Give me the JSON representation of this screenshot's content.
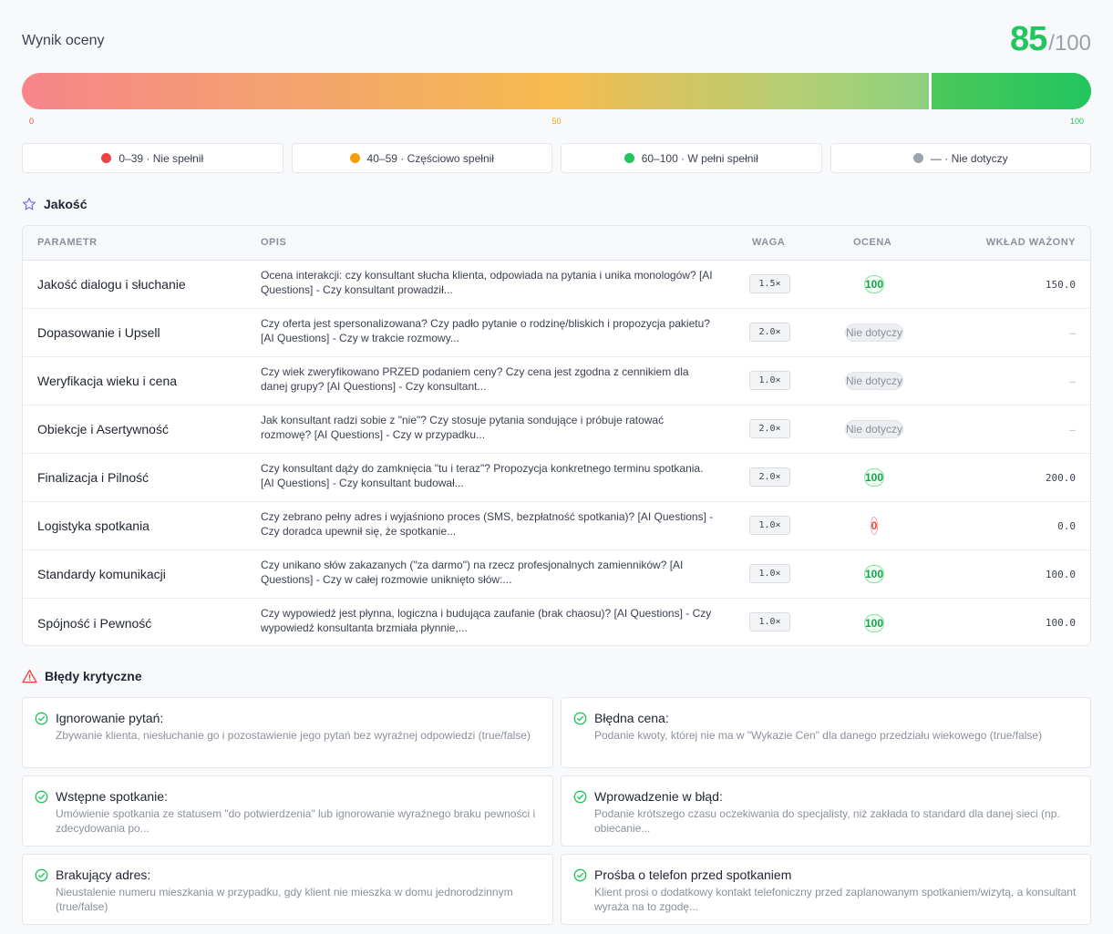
{
  "header": {
    "title": "Wynik oceny",
    "score": "85",
    "score_max": "/100"
  },
  "progress": {
    "value": 85,
    "min_label": "0",
    "mid_label": "50",
    "max_label": "100"
  },
  "legend": [
    {
      "color": "#ef4444",
      "label": "0–39 · Nie spełnił"
    },
    {
      "color": "#f59e0b",
      "label": "40–59 · Częściowo spełnił"
    },
    {
      "color": "#22c55e",
      "label": "60–100 · W pełni spełnił"
    },
    {
      "color": "#9ca3af",
      "label": "— · Nie dotyczy"
    }
  ],
  "quality": {
    "title": "Jakość",
    "columns": {
      "param": "PARAMETR",
      "desc": "OPIS",
      "weight": "WAGA",
      "score": "OCENA",
      "contrib": "WKŁAD WAŻONY"
    },
    "rows": [
      {
        "param": "Jakość dialogu i słuchanie",
        "desc": "Ocena interakcji: czy konsultant słucha klienta, odpowiada na pytania i unika monologów? [AI Questions] - Czy konsultant prowadził...",
        "weight": "1.5×",
        "score": "100",
        "status": "good",
        "contrib": "150.0"
      },
      {
        "param": "Dopasowanie i Upsell",
        "desc": "Czy oferta jest spersonalizowana? Czy padło pytanie o rodzinę/bliskich i propozycja pakietu? [AI Questions] - Czy w trakcie rozmowy...",
        "weight": "2.0×",
        "score": "Nie dotyczy",
        "status": "na",
        "contrib": "–"
      },
      {
        "param": "Weryfikacja wieku i cena",
        "desc": "Czy wiek zweryfikowano PRZED podaniem ceny? Czy cena jest zgodna z cennikiem dla danej grupy? [AI Questions] - Czy konsultant...",
        "weight": "1.0×",
        "score": "Nie dotyczy",
        "status": "na",
        "contrib": "–"
      },
      {
        "param": "Obiekcje i Asertywność",
        "desc": "Jak konsultant radzi sobie z \"nie\"? Czy stosuje pytania sondujące i próbuje ratować rozmowę? [AI Questions] - Czy w przypadku...",
        "weight": "2.0×",
        "score": "Nie dotyczy",
        "status": "na",
        "contrib": "–"
      },
      {
        "param": "Finalizacja i Pilność",
        "desc": "Czy konsultant dąży do zamknięcia \"tu i teraz\"? Propozycja konkretnego terminu spotkania. [AI Questions] - Czy konsultant budował...",
        "weight": "2.0×",
        "score": "100",
        "status": "good",
        "contrib": "200.0"
      },
      {
        "param": "Logistyka spotkania",
        "desc": "Czy zebrano pełny adres i wyjaśniono proces (SMS, bezpłatność spotkania)? [AI Questions] - Czy doradca upewnił się, że spotkanie...",
        "weight": "1.0×",
        "score": "0",
        "status": "bad",
        "contrib": "0.0"
      },
      {
        "param": "Standardy komunikacji",
        "desc": "Czy unikano słów zakazanych (\"za darmo\") na rzecz profesjonalnych zamienników? [AI Questions] - Czy w całej rozmowie uniknięto słów:...",
        "weight": "1.0×",
        "score": "100",
        "status": "good",
        "contrib": "100.0"
      },
      {
        "param": "Spójność i Pewność",
        "desc": "Czy wypowiedź jest płynna, logiczna i budująca zaufanie (brak chaosu)? [AI Questions] - Czy wypowiedź konsultanta brzmiała płynnie,...",
        "weight": "1.0×",
        "score": "100",
        "status": "good",
        "contrib": "100.0"
      }
    ]
  },
  "critical": {
    "title": "Błędy krytyczne",
    "items": [
      {
        "title": "Ignorowanie pytań:",
        "desc": "Zbywanie klienta, niesłuchanie go i pozostawienie jego pytań bez wyraźnej odpowiedzi (true/false)"
      },
      {
        "title": "Błędna cena:",
        "desc": "Podanie kwoty, której nie ma w \"Wykazie Cen\" dla danego przedziału wiekowego (true/false)"
      },
      {
        "title": "Wstępne spotkanie:",
        "desc": "Umówienie spotkania ze statusem \"do potwierdzenia\" lub ignorowanie wyraźnego braku pewności i zdecydowania po..."
      },
      {
        "title": "Wprowadzenie w błąd:",
        "desc": "Podanie krótszego czasu oczekiwania do specjalisty, niż zakłada to standard dla danej sieci (np. obiecanie..."
      },
      {
        "title": "Brakujący adres:",
        "desc": "Nieustalenie numeru mieszkania w przypadku, gdy klient nie mieszka w domu jednorodzinnym (true/false)"
      },
      {
        "title": "Prośba o telefon przed spotkaniem",
        "desc": "Klient prosi o dodatkowy kontakt telefoniczny przed zaplanowanym spotkaniem/wizytą, a konsultant wyraża na to zgodę..."
      }
    ]
  },
  "icons": {
    "quality": "star-icon",
    "critical": "warning-triangle-icon",
    "card": "check-circle-icon"
  },
  "colors": {
    "good": "#22c55e",
    "mid": "#f59e0b",
    "bad": "#ef4444",
    "na": "#9ca3af",
    "accent": "#7c6cf0"
  }
}
